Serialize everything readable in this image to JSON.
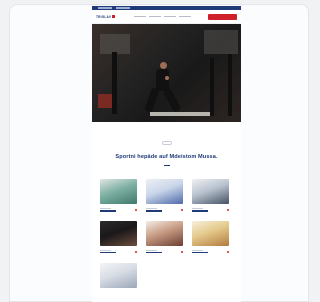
{
  "site": {
    "logo_text": "TRIGLAV",
    "brand_colors": {
      "navy": "#1e3a78",
      "red": "#d0202a"
    }
  },
  "hero": {
    "image": "athlete-box-jump-gym-photo"
  },
  "section": {
    "eyebrow": "",
    "headline": "Sportni hepäde auf Mdeistom Mussa."
  },
  "tiles": [
    {
      "image": "physio-treatment-photo"
    },
    {
      "image": "doctor-consultation-photo"
    },
    {
      "image": "clinic-equipment-photo"
    },
    {
      "image": "athlete-portrait-photo"
    },
    {
      "image": "hand-treatment-photo"
    },
    {
      "image": "yoga-stretch-photo"
    },
    {
      "image": "medical-staff-photo"
    }
  ]
}
